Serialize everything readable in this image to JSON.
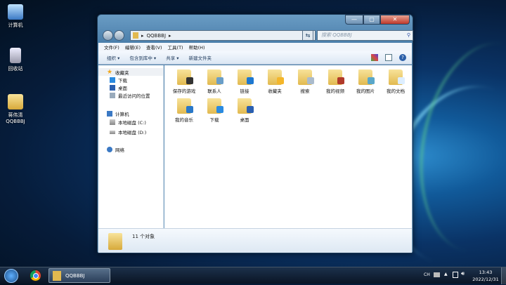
{
  "desktop": {
    "icons": [
      {
        "label": "计算机"
      },
      {
        "label": "回收站"
      },
      {
        "label": "蒋伟清\nQQBBBJ",
        "line1": "蒋伟清",
        "line2": "QQBBBJ"
      }
    ]
  },
  "window": {
    "controls": {
      "minimize": "—",
      "maximize": "▢",
      "close": "✕"
    },
    "path": "QQBBBJ",
    "search_placeholder": "搜索 QQBBBJ",
    "menu": [
      "文件(F)",
      "编辑(E)",
      "查看(V)",
      "工具(T)",
      "帮助(H)"
    ],
    "toolbar": [
      "组织 ▾",
      "包含到库中 ▾",
      "共享 ▾",
      "新建文件夹"
    ],
    "sidebar": {
      "favorites": "收藏夹",
      "fav_items": [
        "下载",
        "桌面",
        "最近访问的位置"
      ],
      "computer": "计算机",
      "drives": [
        "本地磁盘 (C:)",
        "本地磁盘 (D:)"
      ],
      "network": "网络"
    },
    "items": [
      {
        "label": "保存的游戏",
        "color": "#333"
      },
      {
        "label": "联系人",
        "color": "#6a9ec8"
      },
      {
        "label": "链接",
        "color": "#1e78d0"
      },
      {
        "label": "收藏夹",
        "color": "#f4b62a"
      },
      {
        "label": "搜索",
        "color": "#aabbcc"
      },
      {
        "label": "我的视频",
        "color": "#b03a2a"
      },
      {
        "label": "我的图片",
        "color": "#5aa7c9"
      },
      {
        "label": "我的文档",
        "color": "#ddeeff"
      },
      {
        "label": "我的音乐",
        "color": "#2a78c8"
      },
      {
        "label": "下载",
        "color": "#2a8ae0"
      },
      {
        "label": "桌面",
        "color": "#2a5fb0"
      }
    ],
    "status": "11 个对象"
  },
  "taskbar": {
    "active_window": "QQBBBJ",
    "lang": "CH",
    "time": "13:43",
    "date": "2022/12/31"
  }
}
